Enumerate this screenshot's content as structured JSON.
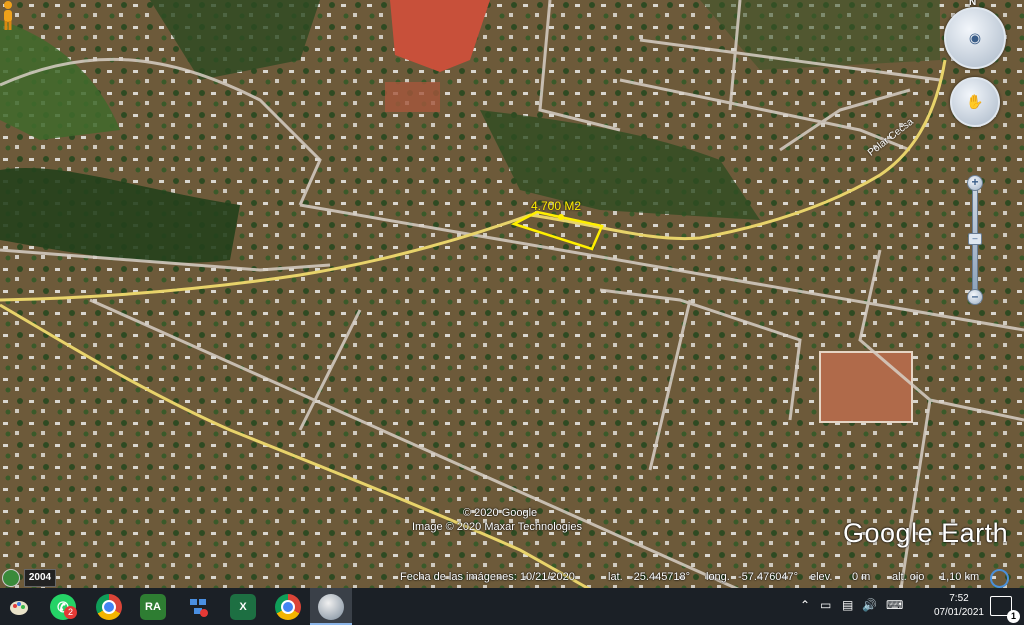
{
  "map": {
    "parcel_label": "4.700 M2",
    "road_label": "Polar Cecsa",
    "copyright_google": "© 2020 Google",
    "copyright_imagery": "Image © 2020 Maxar Technologies",
    "logo_text": "Google Earth",
    "compass_north": "N"
  },
  "status": {
    "year_badge": "2004",
    "imagery_date_label": "Fecha de las imágenes: 10/21/2020",
    "lat_label": "lat.",
    "lat_value": "-25.445718°",
    "long_label": "long.",
    "long_value": "-57.476047°",
    "elev_label": "elev.",
    "elev_value": "0 m",
    "eye_alt_label": "alt. ojo",
    "eye_alt_value": "1,10 km"
  },
  "taskbar": {
    "apps": [
      {
        "name": "Paint",
        "icon": "paint-icon"
      },
      {
        "name": "WhatsApp",
        "icon": "whatsapp-icon",
        "badge": "2"
      },
      {
        "name": "Chrome",
        "icon": "chrome-icon"
      },
      {
        "name": "RA",
        "icon": "ra-icon",
        "label": "RA"
      },
      {
        "name": "Network",
        "icon": "network-icon"
      },
      {
        "name": "Excel",
        "icon": "excel-icon"
      },
      {
        "name": "Chrome profile",
        "icon": "chrome-profile-icon"
      },
      {
        "name": "Google Earth Pro",
        "icon": "google-earth-icon"
      }
    ],
    "clock_time": "7:52",
    "clock_date": "07/01/2021",
    "notification_count": "1"
  },
  "colors": {
    "parcel": "#ffef00",
    "road": "#e8d36a",
    "taskbar": "#1b2026",
    "accent": "#8ab4e6"
  }
}
